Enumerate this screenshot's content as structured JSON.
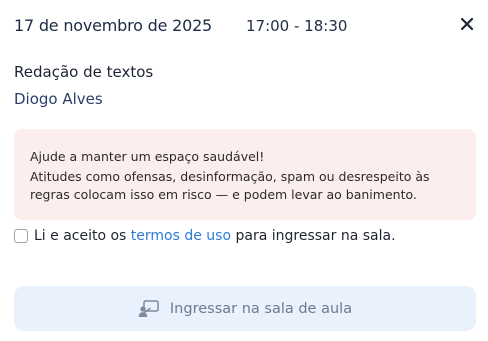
{
  "header": {
    "date": "17 de novembro de 2025",
    "time": "17:00 - 18:30",
    "close_icon": "close-icon"
  },
  "class": {
    "course": "Redação de textos",
    "teacher": "Diogo Alves"
  },
  "warning": {
    "title": "Ajude a manter um espaço saudável!",
    "text": "Atitudes como ofensas, desinformação, spam ou desrespeito às regras colocam isso em risco — e podem levar ao banimento.",
    "background_color": "#fdeeee"
  },
  "terms": {
    "checked": false,
    "prefix": "Li e aceito os ",
    "link": "termos de uso",
    "suffix": " para ingressar na sala.",
    "link_color": "#2d7bd8"
  },
  "join_button": {
    "label": "Ingressar na sala de aula",
    "icon": "classroom-icon",
    "enabled": false,
    "background_color": "#e8f1fc"
  }
}
